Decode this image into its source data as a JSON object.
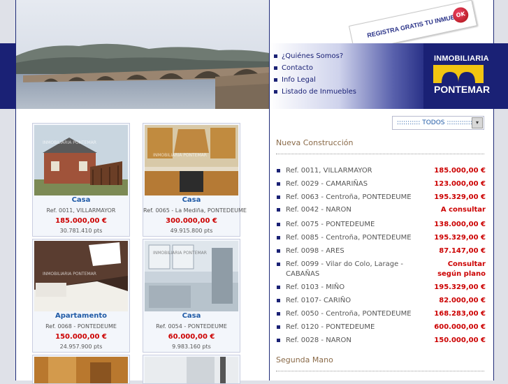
{
  "header": {
    "stamp_text": "REGISTRA GRATIS TU INMUEBLE",
    "stamp_ok": "OK",
    "logo_line1": "INMOBILIARIA",
    "logo_line2": "PONTEMAR"
  },
  "menu": {
    "items": [
      {
        "label": "¿Quiénes Somos?"
      },
      {
        "label": "Contacto"
      },
      {
        "label": "Info Legal"
      },
      {
        "label": "Listado de Inmuebles"
      }
    ]
  },
  "watermark": "INMOBILIARIA PONTEMAR",
  "listings": [
    {
      "type": "Casa",
      "ref": "Ref. 0011, VILLARMAYOR",
      "price": "185.000,00 €",
      "pts": "30.781.410 pts"
    },
    {
      "type": "Casa",
      "ref": "Ref. 0065 - La Mediña, PONTEDEUME",
      "price": "300.000,00 €",
      "pts": "49.915.800 pts"
    },
    {
      "type": "Apartamento",
      "ref": "Ref. 0068 - PONTEDEUME",
      "price": "150.000,00 €",
      "pts": "24.957.900 pts"
    },
    {
      "type": "Casa",
      "ref": "Ref. 0054 - PONTEDEUME",
      "price": "60.000,00 €",
      "pts": "9.983.160 pts"
    }
  ],
  "filter": {
    "label": "::::::::::: TODOS ::::::::::::"
  },
  "sections": {
    "new": "Nueva Construcción",
    "second": "Segunda Mano"
  },
  "properties": [
    {
      "name": "Ref. 0011, VILLARMAYOR",
      "price": "185.000,00 €"
    },
    {
      "name": "Ref. 0029 - CAMARIÑAS",
      "price": "123.000,00 €"
    },
    {
      "name": "Ref. 0063 - Centroña, PONTEDEUME",
      "price": "195.329,00 €"
    },
    {
      "name": "Ref. 0042 - NARON",
      "price": "A consultar"
    },
    {
      "name": "Ref. 0075 - PONTEDEUME",
      "price": "138.000,00 €"
    },
    {
      "name": "Ref. 0085 - Centroña, PONTEDEUME",
      "price": "195.329,00 €"
    },
    {
      "name": "Ref. 0098 - ARES",
      "price": "87.147,00 €"
    },
    {
      "name": "Ref. 0099 - Vilar do Colo, Larage - CABAÑAS",
      "price": "Consultar según plano"
    },
    {
      "name": "Ref. 0103 - MIÑO",
      "price": "195.329,00 €"
    },
    {
      "name": "Ref. 0107- CARIÑO",
      "price": "82.000,00 €"
    },
    {
      "name": "Ref. 0050 - Centroña, PONTEDEUME",
      "price": "168.283,00 €"
    },
    {
      "name": "Ref. 0120 - PONTEDEUME",
      "price": "600.000,00 €"
    },
    {
      "name": "Ref. 0028 - NARON",
      "price": "150.000,00 €"
    }
  ]
}
